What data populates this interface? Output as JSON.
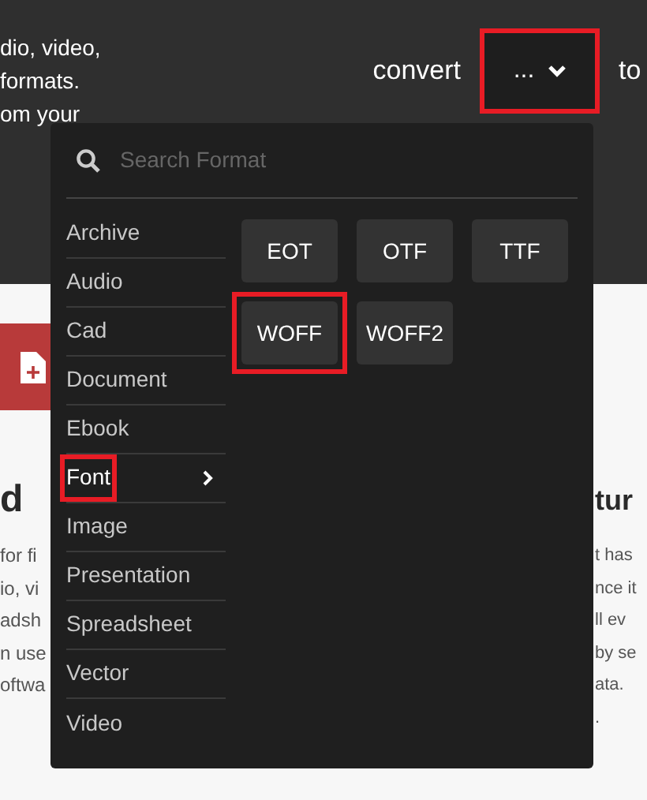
{
  "header": {
    "intro_lines": [
      "dio, video,",
      "formats.",
      "om your"
    ],
    "convert_label": "convert",
    "dropdown": {
      "label": "...",
      "highlighted": true
    },
    "to_label": "to"
  },
  "left_column": {
    "heading": "d",
    "lines": [
      "for fi",
      "io, vi",
      "adsh",
      "n use",
      "oftwa"
    ]
  },
  "right_column": {
    "heading": "tur",
    "lines": [
      "t has",
      "nce it",
      "ll ev",
      "by se",
      "ata.",
      "."
    ]
  },
  "menu": {
    "search": {
      "placeholder": "Search Format"
    },
    "categories": [
      {
        "label": "Archive",
        "selected": false,
        "highlighted": false
      },
      {
        "label": "Audio",
        "selected": false,
        "highlighted": false
      },
      {
        "label": "Cad",
        "selected": false,
        "highlighted": false
      },
      {
        "label": "Document",
        "selected": false,
        "highlighted": false
      },
      {
        "label": "Ebook",
        "selected": false,
        "highlighted": false
      },
      {
        "label": "Font",
        "selected": true,
        "highlighted": true
      },
      {
        "label": "Image",
        "selected": false,
        "highlighted": false
      },
      {
        "label": "Presentation",
        "selected": false,
        "highlighted": false
      },
      {
        "label": "Spreadsheet",
        "selected": false,
        "highlighted": false
      },
      {
        "label": "Vector",
        "selected": false,
        "highlighted": false
      },
      {
        "label": "Video",
        "selected": false,
        "highlighted": false
      }
    ],
    "formats": [
      {
        "label": "EOT",
        "highlighted": false
      },
      {
        "label": "OTF",
        "highlighted": false
      },
      {
        "label": "TTF",
        "highlighted": false
      },
      {
        "label": "WOFF",
        "highlighted": true
      },
      {
        "label": "WOFF2",
        "highlighted": false
      }
    ]
  }
}
